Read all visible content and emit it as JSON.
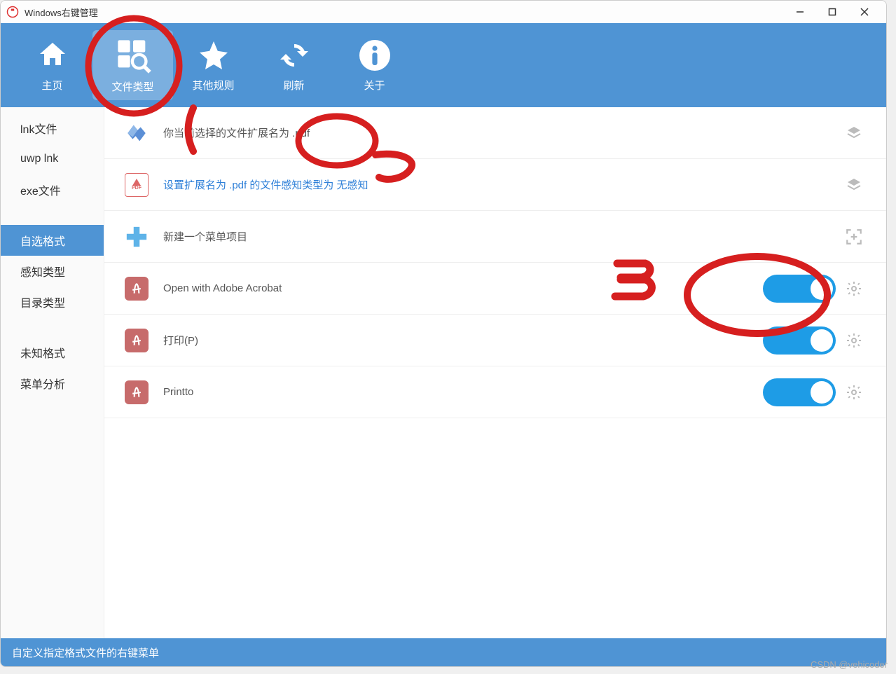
{
  "window": {
    "title": "Windows右键管理"
  },
  "toolbar": [
    {
      "key": "home",
      "label": "主页"
    },
    {
      "key": "filetype",
      "label": "文件类型",
      "active": true
    },
    {
      "key": "other",
      "label": "其他规则"
    },
    {
      "key": "refresh",
      "label": "刷新"
    },
    {
      "key": "about",
      "label": "关于"
    }
  ],
  "sidebar": {
    "group1": [
      {
        "label": "lnk文件"
      },
      {
        "label": "uwp lnk"
      },
      {
        "label": "exe文件"
      }
    ],
    "group2": [
      {
        "label": "自选格式",
        "active": true
      },
      {
        "label": "感知类型"
      },
      {
        "label": "目录类型"
      }
    ],
    "group3": [
      {
        "label": "未知格式"
      },
      {
        "label": "菜单分析"
      }
    ]
  },
  "main": {
    "info_row": {
      "text": "你当前选择的文件扩展名为 .pdf"
    },
    "perceive_row": {
      "text": "设置扩展名为 .pdf 的文件感知类型为 无感知"
    },
    "new_row": {
      "text": "新建一个菜单项目"
    },
    "items": [
      {
        "label": "Open with Adobe Acrobat",
        "enabled": true
      },
      {
        "label": "打印(P)",
        "enabled": true
      },
      {
        "label": "Printto",
        "enabled": true
      }
    ]
  },
  "statusbar": {
    "text": "自定义指定格式文件的右键菜单"
  },
  "annotations": {
    "num1": "1",
    "num2": "2",
    "num3": "3"
  },
  "watermark": "CSDN @vehicoder"
}
